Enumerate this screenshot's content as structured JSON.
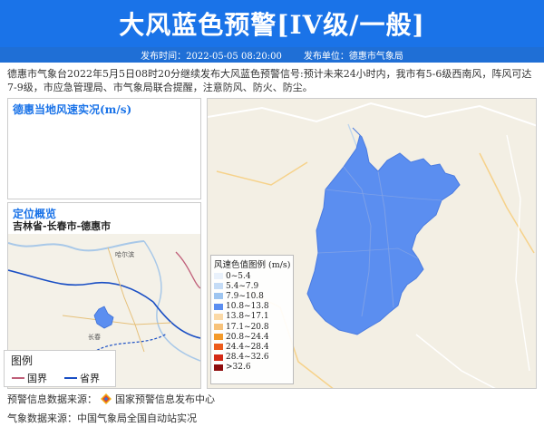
{
  "header": {
    "title": "大风蓝色预警[IV级/一般]",
    "publish_time_label": "发布时间：2022-05-05 08:20:00",
    "publisher_label": "发布单位：德惠市气象局"
  },
  "description": "德惠市气象台2022年5月5日08时20分继续发布大风蓝色预警信号:预计未来24小时内，我市有5-6级西南风，阵风可达7-9级，市应急管理局、市气象局联合提醒，注意防风、防火、防尘。",
  "wind_panel": {
    "title": "德惠当地风速实况(m/s)"
  },
  "location_panel": {
    "title": "定位概览",
    "location_path": "吉林省-长春市-德惠市",
    "city_labels": [
      "哈尔滨",
      "长春"
    ]
  },
  "map_legend": {
    "title": "图例",
    "items": [
      {
        "label": "国界",
        "color": "#c0607a"
      },
      {
        "label": "省界",
        "color": "#1a4fc4"
      }
    ]
  },
  "wind_legend": {
    "title": "风速色值图例 (m/s)",
    "items": [
      {
        "label": "0~5.4",
        "color": "#e9f1fb"
      },
      {
        "label": "5.4~7.9",
        "color": "#c5dcf6"
      },
      {
        "label": "7.9~10.8",
        "color": "#9ec5f0"
      },
      {
        "label": "10.8~13.8",
        "color": "#5b8ef0"
      },
      {
        "label": "13.8~17.1",
        "color": "#fbd9a6"
      },
      {
        "label": "17.1~20.8",
        "color": "#f7c27a"
      },
      {
        "label": "20.8~24.4",
        "color": "#f39a2b"
      },
      {
        "label": "24.4~28.4",
        "color": "#ec5b1b"
      },
      {
        "label": "28.4~32.6",
        "color": "#d42b17"
      },
      {
        "label": ">32.6",
        "color": "#8e0d0d"
      }
    ]
  },
  "footer": {
    "warning_source_label": "预警信息数据来源：",
    "warning_source": "国家预警信息发布中心",
    "weather_source": "气象数据来源：中国气象局全国自动站实况"
  },
  "colors": {
    "banner": "#1a73e8",
    "region_fill": "#5b8ef0",
    "accent": "#1a73e8"
  }
}
